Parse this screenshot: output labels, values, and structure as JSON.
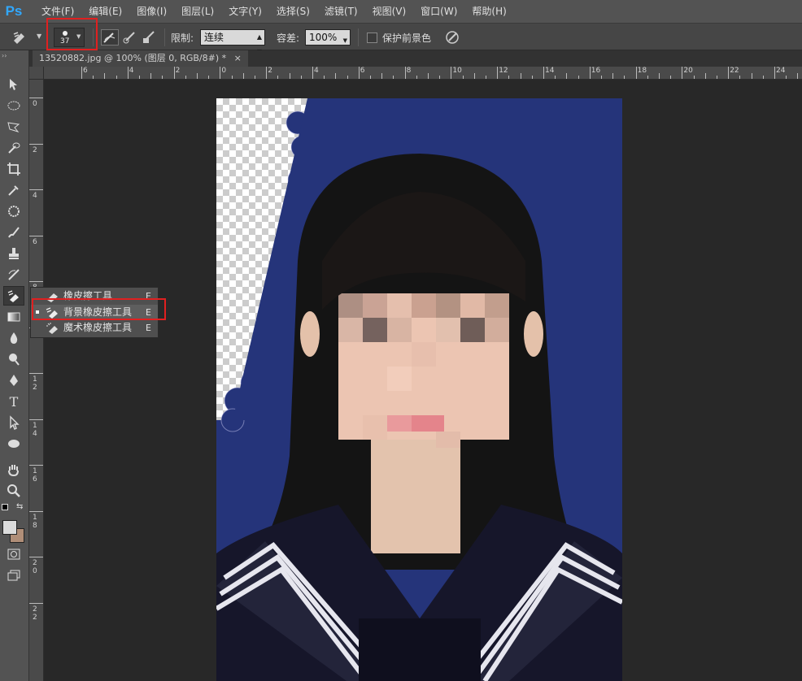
{
  "app": {
    "logo": "Ps",
    "accent": "#31a8ff"
  },
  "menu": [
    "文件(F)",
    "编辑(E)",
    "图像(I)",
    "图层(L)",
    "文字(Y)",
    "选择(S)",
    "滤镜(T)",
    "视图(V)",
    "窗口(W)",
    "帮助(H)"
  ],
  "options": {
    "brush_size": "37",
    "limit_label": "限制:",
    "limit_value": "连续",
    "tolerance_label": "容差:",
    "tolerance_value": "100%",
    "protect_fg_label": "保护前景色",
    "protect_fg_checked": false
  },
  "document": {
    "tab_title": "13520882.jpg @ 100% (图层 0, RGB/8#) *",
    "close_glyph": "×"
  },
  "ruler_top": [
    "6",
    "4",
    "2",
    "0",
    "2",
    "4",
    "6",
    "8",
    "10",
    "12",
    "14",
    "16",
    "18",
    "20",
    "22",
    "24"
  ],
  "ruler_left": [
    "0",
    "2",
    "4",
    "6",
    "8",
    "0",
    "1\n2",
    "1\n4",
    "1\n6",
    "1\n8",
    "2\n0",
    "2\n2"
  ],
  "flyout": {
    "items": [
      {
        "label": "橡皮擦工具",
        "key": "E",
        "selected": false
      },
      {
        "label": "背景橡皮擦工具",
        "key": "E",
        "selected": true
      },
      {
        "label": "魔术橡皮擦工具",
        "key": "E",
        "selected": false
      }
    ]
  },
  "colors": {
    "highlight": "#e02020",
    "photo_bg": "#25347a"
  }
}
